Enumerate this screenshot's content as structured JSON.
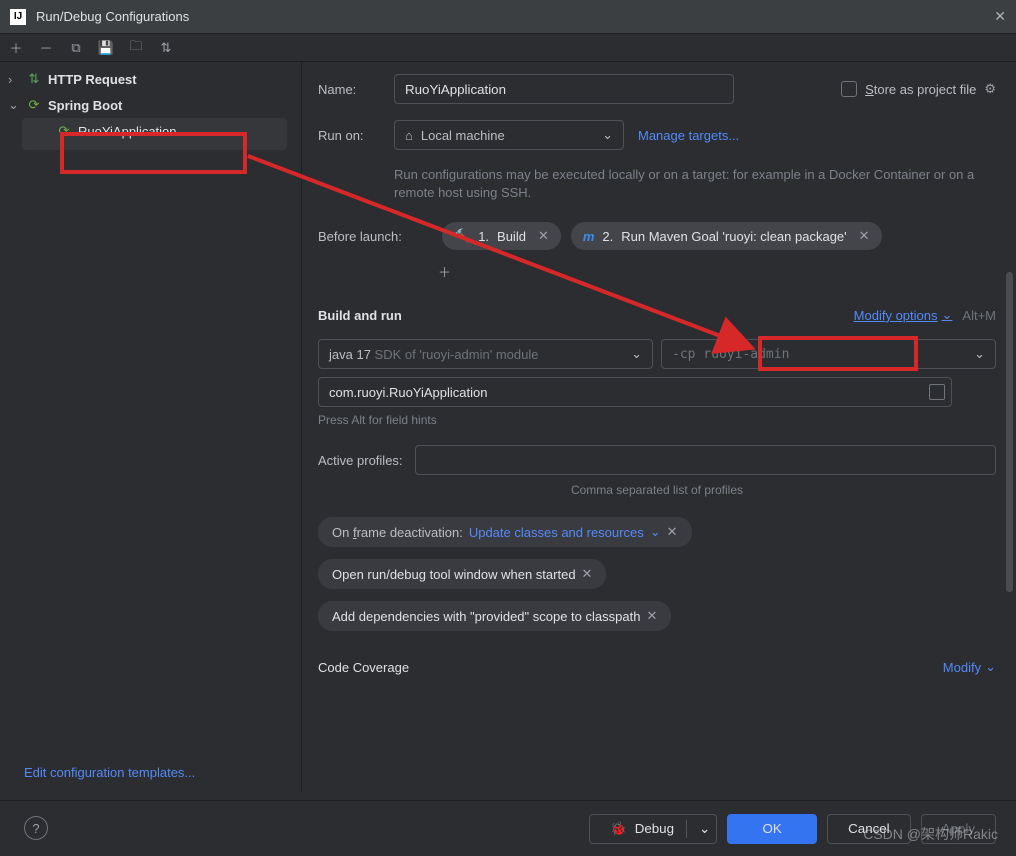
{
  "window": {
    "title": "Run/Debug Configurations"
  },
  "tree": {
    "http": {
      "label": "HTTP Request"
    },
    "spring": {
      "label": "Spring Boot"
    },
    "app": {
      "label": "RuoYiApplication"
    }
  },
  "form": {
    "name_label": "Name:",
    "name_value": "RuoYiApplication",
    "store_prefix": "S",
    "store_rest": "tore as project file",
    "runon_label": "Run on:",
    "runon_value": "Local machine",
    "manage": "Manage targets...",
    "hint": "Run configurations may be executed locally or on a target: for example in a Docker Container or on a remote host using SSH.",
    "before_label": "Before launch:",
    "task1_num": "1.",
    "task1_label": "Build",
    "task2_prefix": "m",
    "task2_num": "2.",
    "task2_label": "Run Maven Goal 'ruoyi: clean package'",
    "buildrun": "Build and run",
    "modify": "Modify options",
    "modify_key": "Alt+M",
    "sdk_main": "java 17 ",
    "sdk_ghost": "SDK of 'ruoyi-admin' module",
    "cp_ghost": "-cp ruoyi-admin",
    "mainclass": "com.ruoyi.RuoYiApplication",
    "press_hint": "Press Alt for field hints",
    "profiles_label": "Active profiles:",
    "profiles_hint": "Comma separated list of profiles",
    "onframe_label": "On frame deactivation:",
    "onframe_f": "f",
    "onframe_pre": "On ",
    "onframe_post": "rame deactivation:",
    "onframe_val": "Update classes and resources",
    "opt2": "Open run/debug tool window when started",
    "opt3": "Add dependencies with \"provided\" scope to classpath",
    "coverage": "Code Coverage",
    "cov_modify": "Modify"
  },
  "footer": {
    "edit_tmpl": "Edit configuration templates...",
    "debug": "Debug",
    "ok": "OK",
    "cancel": "Cancel",
    "apply": "Apply"
  },
  "watermark": "CSDN @架构师Rakic"
}
